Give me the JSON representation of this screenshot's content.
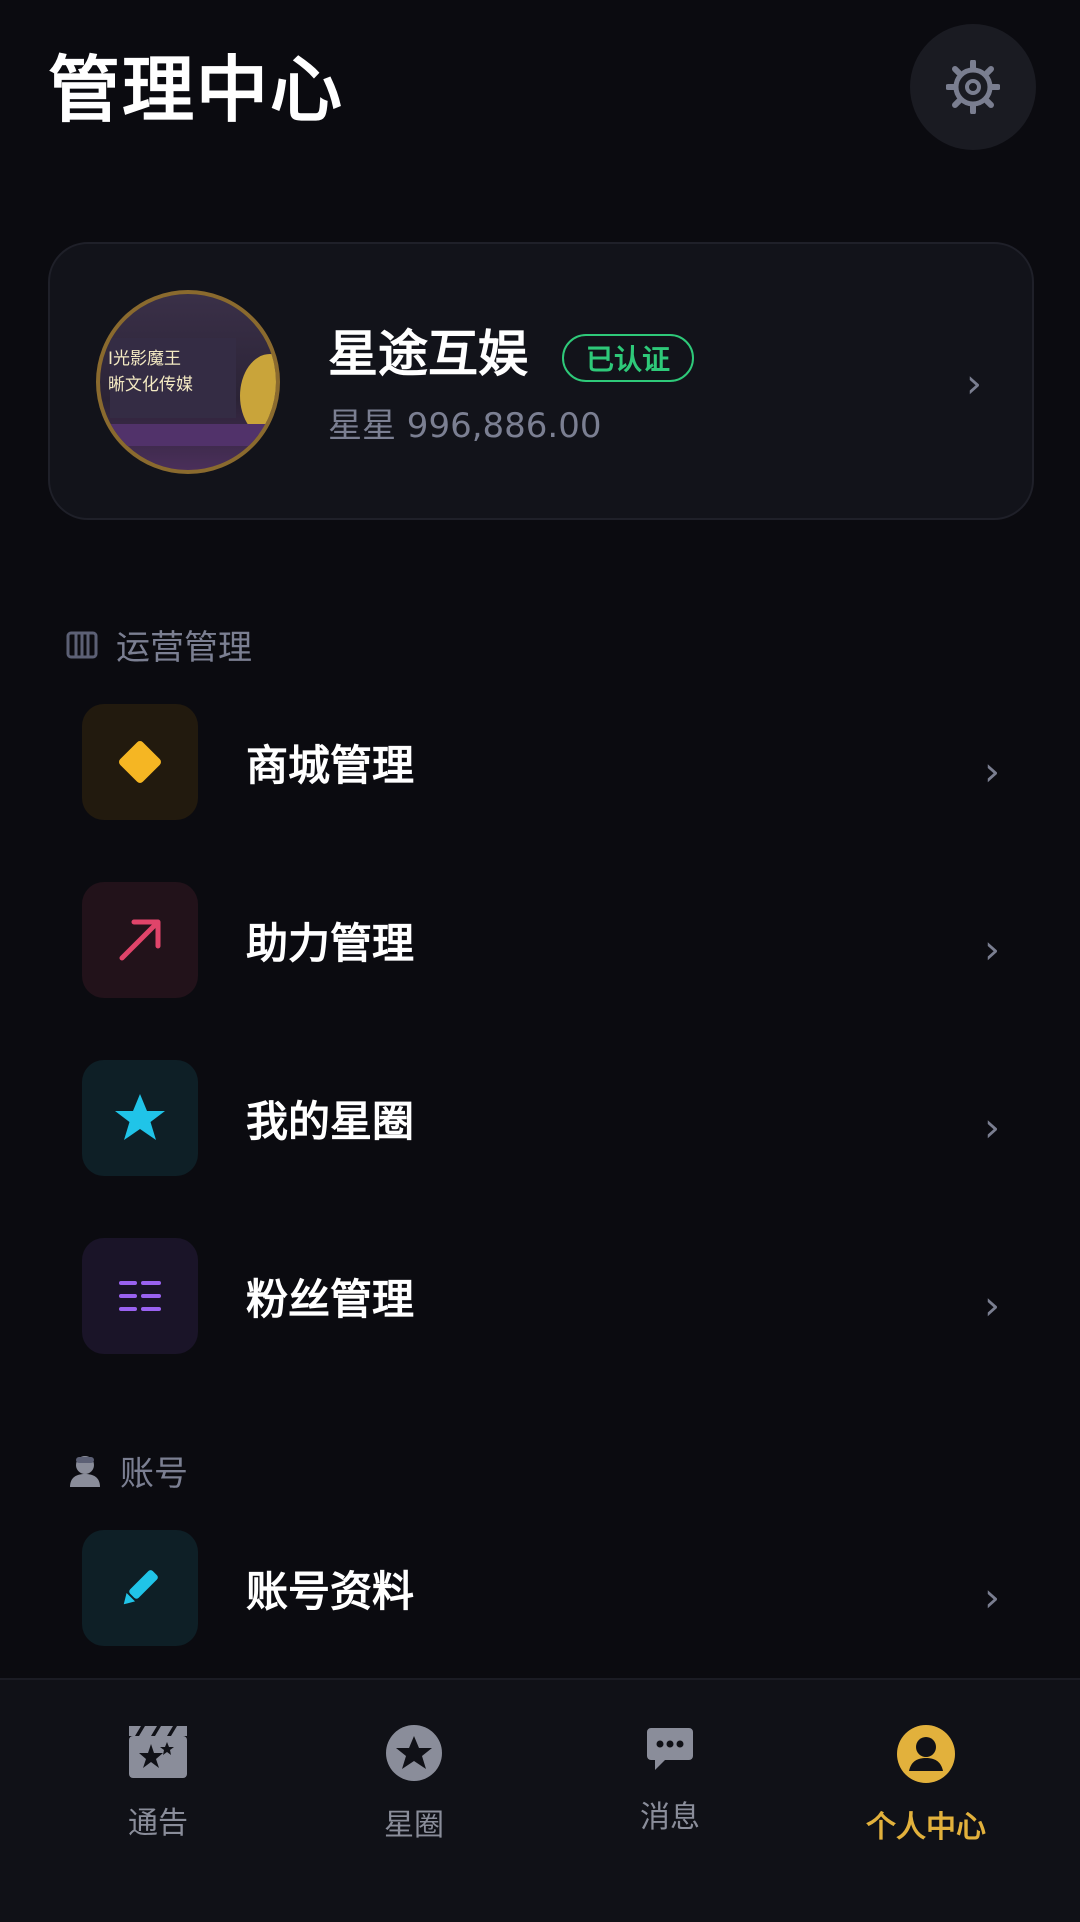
{
  "header": {
    "title": "管理中心",
    "settings_icon": "gear-icon"
  },
  "profile": {
    "name": "星途互娱",
    "badge": "已认证",
    "balance": "星星 996,886.00",
    "avatar_text_line1": "I光影魔王",
    "avatar_text_line2": "晰文化传媒"
  },
  "sections": {
    "operations": {
      "label": "运营管理",
      "icon": "columns-icon"
    },
    "account": {
      "label": "账号",
      "icon": "user-icon"
    }
  },
  "menu": [
    {
      "label": "商城管理",
      "icon": "diamond-icon",
      "accent": "#f5b623"
    },
    {
      "label": "助力管理",
      "icon": "trend-arrow-icon",
      "accent": "#e0446a"
    },
    {
      "label": "我的星圈",
      "icon": "star-icon",
      "accent": "#20c4e8"
    },
    {
      "label": "粉丝管理",
      "icon": "list-icon",
      "accent": "#9a62f0"
    },
    {
      "label": "账号资料",
      "icon": "pencil-icon",
      "accent": "#20c4e8"
    }
  ],
  "tabs": [
    {
      "label": "通告",
      "icon": "clapperboard-icon",
      "active": false
    },
    {
      "label": "星圈",
      "icon": "star-circle-icon",
      "active": false
    },
    {
      "label": "消息",
      "icon": "chat-icon",
      "active": false
    },
    {
      "label": "个人中心",
      "icon": "user-circle-icon",
      "active": true
    }
  ],
  "colors": {
    "background": "#0b0b10",
    "accent_active": "#e2b13c",
    "verified": "#2ec979"
  }
}
